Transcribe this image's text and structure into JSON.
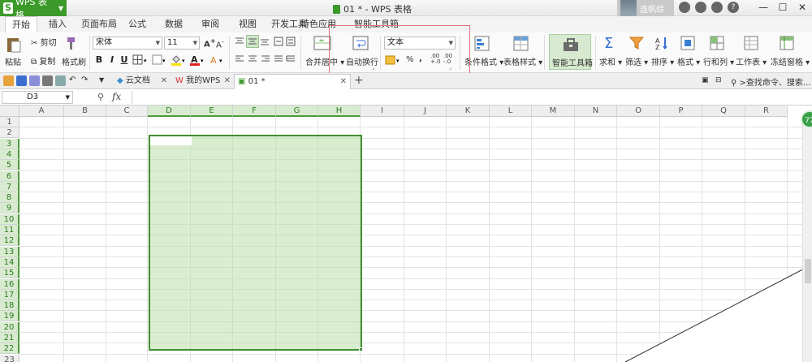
{
  "app": {
    "badge": "WPS 表格",
    "doc_title": "01 * - WPS 表格",
    "user_label": "连帆综",
    "win_min": "—",
    "win_max": "☐",
    "win_close": "✕",
    "tb_icon_help": "?"
  },
  "menu": {
    "tabs": [
      "开始",
      "插入",
      "页面布局",
      "公式",
      "数据",
      "审阅",
      "视图",
      "开发工具",
      "特色应用",
      "智能工具箱"
    ]
  },
  "ribbon": {
    "paste": "粘贴",
    "cut": "剪切",
    "copy": "复制",
    "format_painter": "格式刷",
    "font_name": "宋体",
    "font_size": "11",
    "bold": "B",
    "italic": "I",
    "underline": "U",
    "merge_center": "合并居中",
    "wrap_text": "自动换行",
    "number_format": "文本",
    "percent": "%",
    "comma": ",",
    "inc_decimal": ".00",
    "dec_decimal": ".00",
    "cond_format": "条件格式",
    "table_style": "表格样式",
    "smart_toolbox": "智能工具箱",
    "sum": "求和",
    "filter": "筛选",
    "sort": "排序",
    "format": "格式",
    "rows_cols": "行和列",
    "worksheet": "工作表",
    "freeze": "冻结窗格"
  },
  "doctabs": {
    "cloud": "云文档",
    "mywps": "我的WPS",
    "current": "01 *",
    "add": "+",
    "search": ">查找命令、搜索..."
  },
  "formula": {
    "cell_ref": "D3",
    "fx": "fx"
  },
  "grid": {
    "columns": [
      "A",
      "B",
      "C",
      "D",
      "E",
      "F",
      "G",
      "H",
      "I",
      "J",
      "K",
      "L",
      "M",
      "N",
      "O",
      "P",
      "Q",
      "R"
    ],
    "rows": [
      "1",
      "2",
      "3",
      "4",
      "5",
      "6",
      "7",
      "8",
      "9",
      "10",
      "11",
      "12",
      "13",
      "14",
      "15",
      "16",
      "17",
      "18",
      "19",
      "20",
      "21",
      "22",
      "23"
    ],
    "float_ball": "77"
  },
  "colors": {
    "accent": "#3c9a2a",
    "selection": "#badea8",
    "highlight": "#e0707a"
  }
}
